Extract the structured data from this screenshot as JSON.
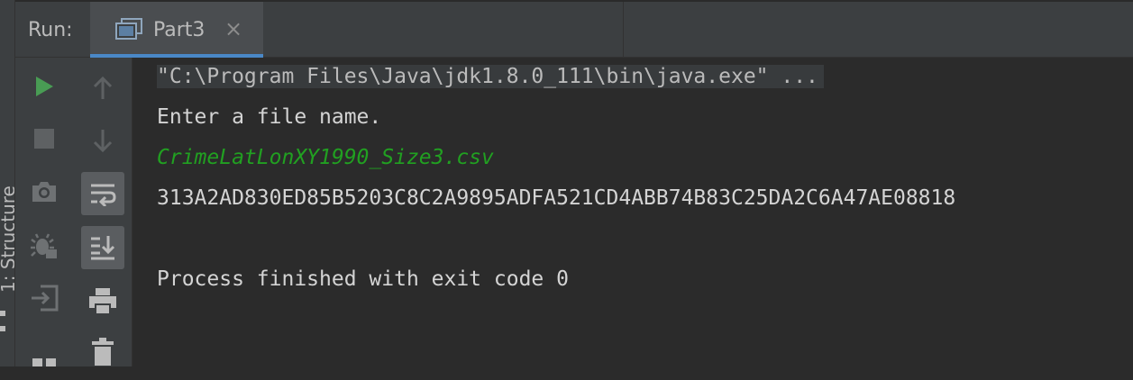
{
  "sidebar": {
    "structure_label": "1: Structure"
  },
  "header": {
    "run_label": "Run:",
    "tab": {
      "label": "Part3",
      "close": "×"
    }
  },
  "console": {
    "command": "\"C:\\Program Files\\Java\\jdk1.8.0_111\\bin\\java.exe\" ...",
    "prompt": "Enter a file name.",
    "user_input": "CrimeLatLonXY1990_Size3.csv",
    "hash_output": "313A2AD830ED85B5203C8C2A9895ADFA521CD4ABB74B83C25DA2C6A47AE08818",
    "exit_message": "Process finished with exit code 0"
  },
  "colors": {
    "background": "#2b2b2b",
    "panel": "#3c3f41",
    "accent": "#4a88c7",
    "run_green": "#499c54",
    "input_green": "#21a021"
  },
  "icons": {
    "toolbar1": [
      "run-icon",
      "stop-icon",
      "camera-icon",
      "debug-icon",
      "exit-icon",
      "layout-icon"
    ],
    "toolbar2": [
      "up-arrow-icon",
      "down-arrow-icon",
      "soft-wrap-icon",
      "scroll-to-end-icon",
      "print-icon",
      "trash-icon"
    ]
  }
}
